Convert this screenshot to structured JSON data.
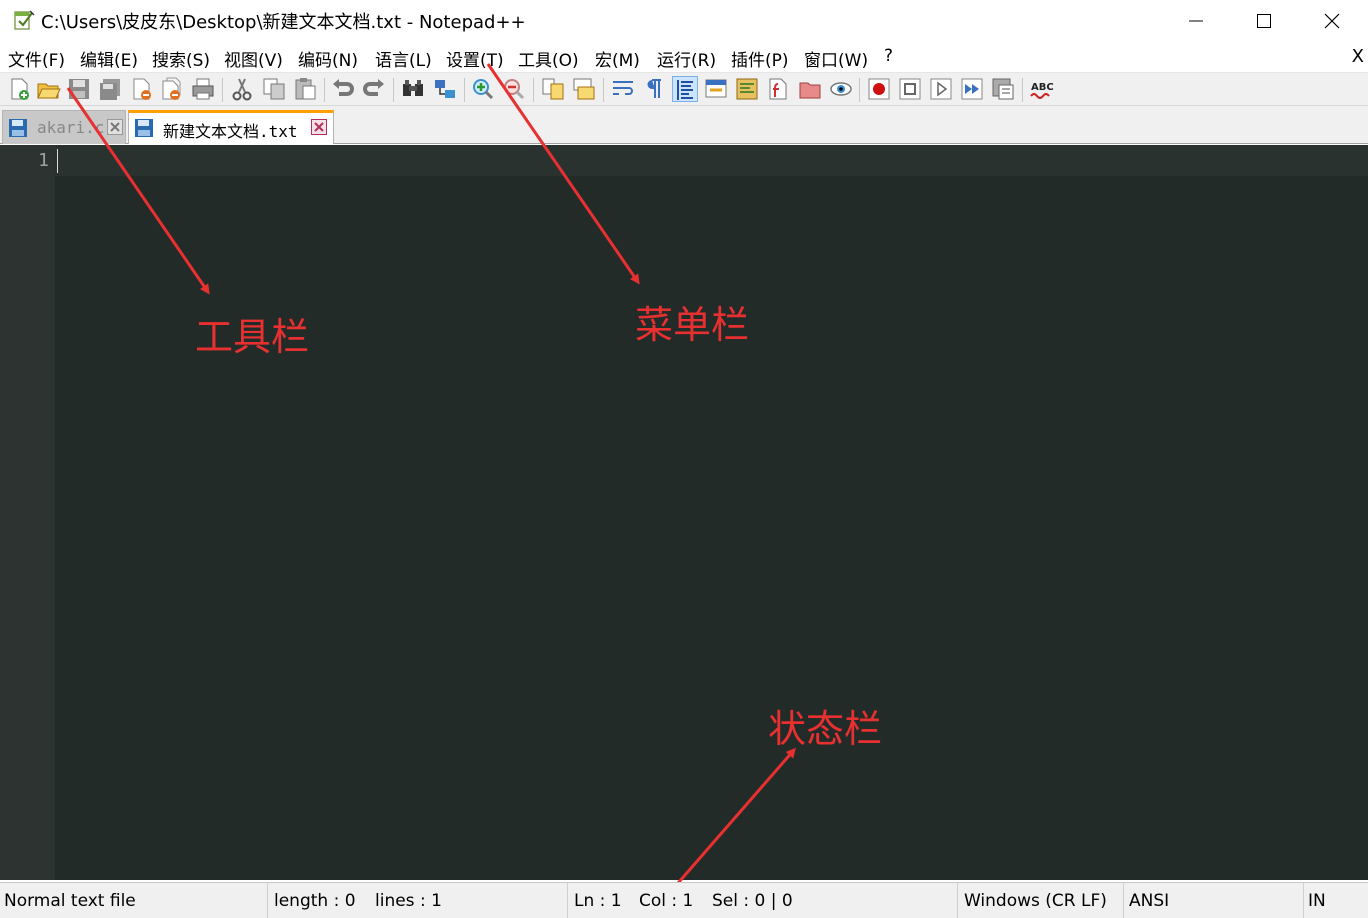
{
  "window": {
    "title": "C:\\Users\\皮皮东\\Desktop\\新建文本文档.txt - Notepad++",
    "icon": "notepadpp-app-icon"
  },
  "menu": {
    "items": [
      {
        "label": "文件(F)"
      },
      {
        "label": "编辑(E)"
      },
      {
        "label": "搜索(S)"
      },
      {
        "label": "视图(V)"
      },
      {
        "label": "编码(N)"
      },
      {
        "label": "语言(L)"
      },
      {
        "label": "设置(T)"
      },
      {
        "label": "工具(O)"
      },
      {
        "label": "宏(M)"
      },
      {
        "label": "运行(R)"
      },
      {
        "label": "插件(P)"
      },
      {
        "label": "窗口(W)"
      },
      {
        "label": "?"
      }
    ],
    "close_doc": "X"
  },
  "toolbar": {
    "icons": [
      "new-file-icon",
      "open-file-icon",
      "save-icon",
      "save-all-icon",
      "close-icon",
      "close-all-icon",
      "print-icon",
      "cut-icon",
      "copy-icon",
      "paste-icon",
      "undo-icon",
      "redo-icon",
      "find-icon",
      "replace-icon",
      "zoom-in-icon",
      "zoom-out-icon",
      "sync-vertical-icon",
      "sync-horizontal-icon",
      "word-wrap-icon",
      "show-all-chars-icon",
      "indent-guide-icon",
      "udl-icon",
      "doc-map-icon",
      "function-list-icon",
      "folder-workspace-icon",
      "monitoring-icon",
      "record-macro-icon",
      "stop-macro-icon",
      "play-macro-icon",
      "run-macro-multiple-icon",
      "save-macro-icon",
      "spell-check-icon"
    ]
  },
  "tabs": [
    {
      "label": "akari.c",
      "active": false
    },
    {
      "label": "新建文本文档.txt",
      "active": true
    }
  ],
  "editor": {
    "line_number": "1",
    "background": "#232b29"
  },
  "annotations": {
    "toolbar": "工具栏",
    "menubar": "菜单栏",
    "statusbar": "状态栏",
    "color": "#e83030"
  },
  "statusbar": {
    "filetype": "Normal text file",
    "length": "length : 0",
    "lines": "lines : 1",
    "ln": "Ln : 1",
    "col": "Col : 1",
    "sel": "Sel : 0 | 0",
    "eol": "Windows (CR LF)",
    "encoding": "ANSI",
    "mode": "IN"
  }
}
